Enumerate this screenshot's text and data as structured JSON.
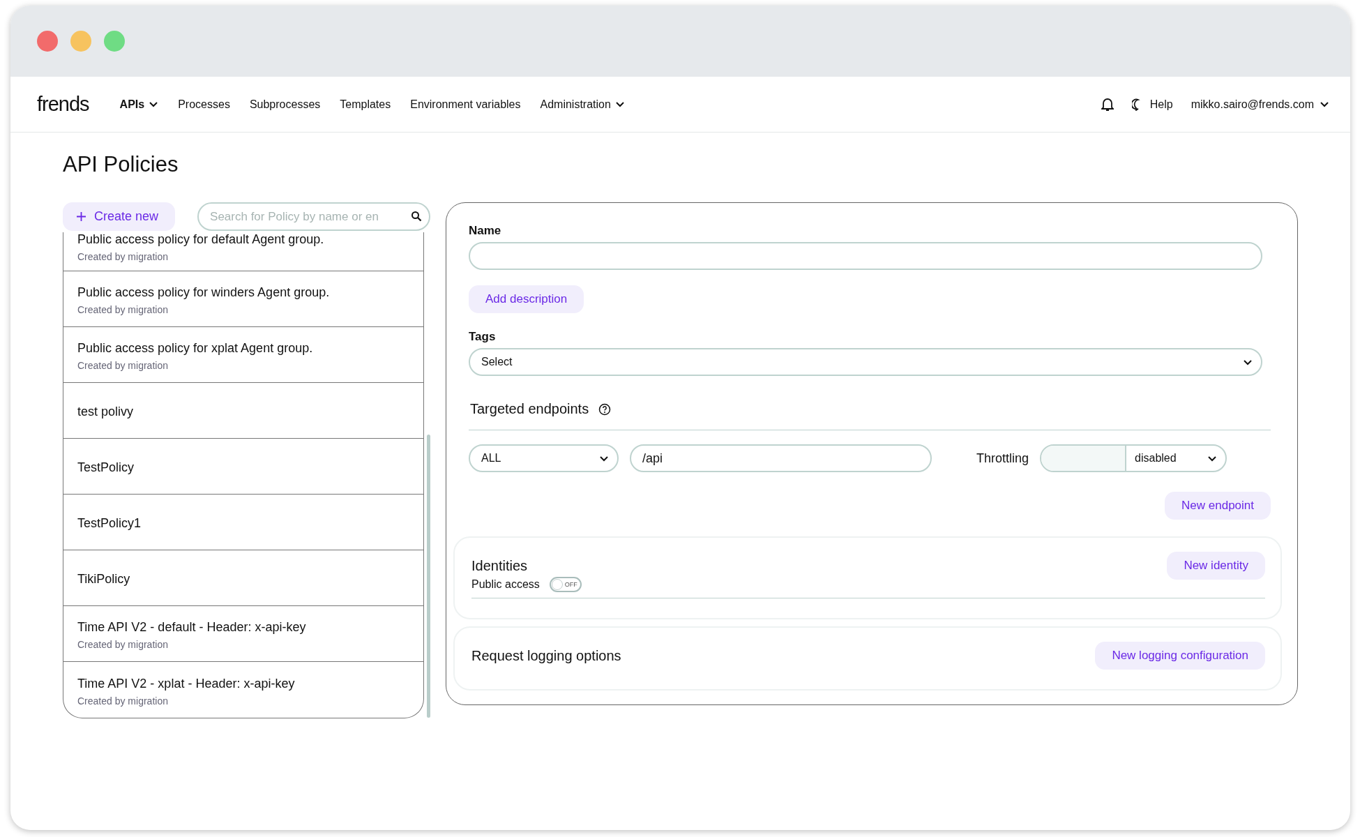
{
  "nav": {
    "logo": "frends",
    "items": [
      {
        "label": "APIs",
        "selected": true,
        "has_menu": true
      },
      {
        "label": "Processes",
        "selected": false,
        "has_menu": false
      },
      {
        "label": "Subprocesses",
        "selected": false,
        "has_menu": false
      },
      {
        "label": "Templates",
        "selected": false,
        "has_menu": false
      },
      {
        "label": "Environment variables",
        "selected": false,
        "has_menu": false
      },
      {
        "label": "Administration",
        "selected": false,
        "has_menu": true
      }
    ],
    "help": "Help",
    "user": "mikko.sairo@frends.com"
  },
  "page_title": "API Policies",
  "toolbar": {
    "create_button": "Create new",
    "search": {
      "placeholder": "Search for Policy by name or en"
    }
  },
  "policies": [
    {
      "name": "Public access policy for default Agent group.",
      "subtitle": "Created by migration"
    },
    {
      "name": "Public access policy for winders Agent group.",
      "subtitle": "Created by migration"
    },
    {
      "name": "Public access policy for xplat Agent group.",
      "subtitle": "Created by migration"
    },
    {
      "name": "test polivy"
    },
    {
      "name": "TestPolicy"
    },
    {
      "name": "TestPolicy1"
    },
    {
      "name": "TikiPolicy"
    },
    {
      "name": "Time API V2 - default - Header: x-api-key",
      "subtitle": "Created by migration"
    },
    {
      "name": "Time API V2 - xplat - Header: x-api-key",
      "subtitle": "Created by migration"
    }
  ],
  "form": {
    "name_label": "Name",
    "add_description": "Add description",
    "tags_label": "Tags",
    "tags_select": "Select",
    "endpoints": {
      "heading": "Targeted endpoints",
      "method": "ALL",
      "path": "/api",
      "throttling_label": "Throttling",
      "throttling_mode": "disabled",
      "new_endpoint": "New endpoint"
    },
    "identities": {
      "heading": "Identities",
      "public_access_label": "Public access",
      "public_access": {
        "on": false,
        "text": "OFF"
      },
      "new_identity": "New identity"
    },
    "logging": {
      "heading": "Request logging options",
      "new_logging": "New logging configuration"
    }
  }
}
